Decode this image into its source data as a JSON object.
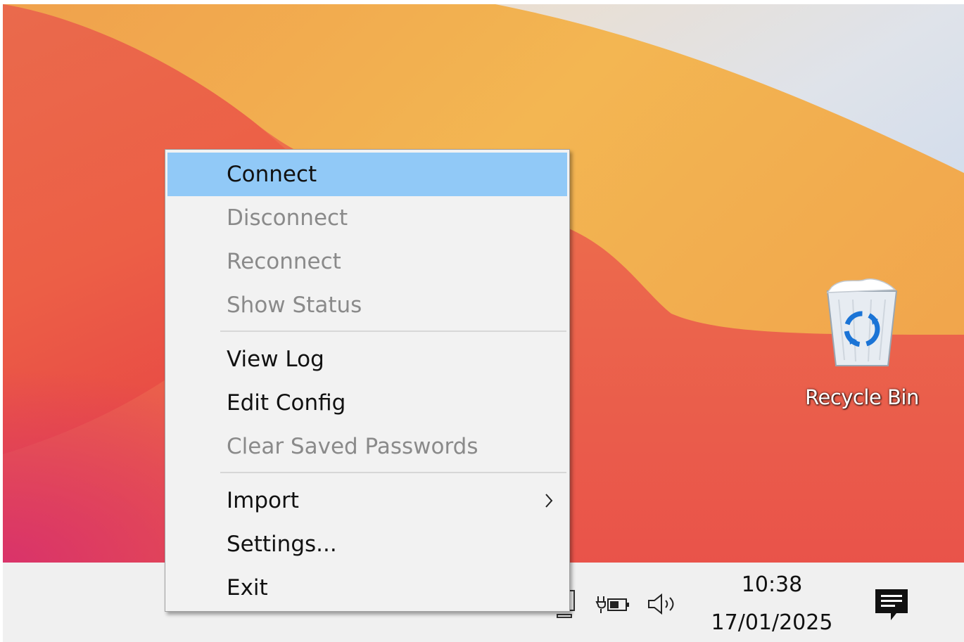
{
  "desktop": {
    "icons": [
      {
        "label": "Recycle Bin",
        "icon": "recycle-bin-icon"
      }
    ]
  },
  "context_menu": {
    "items": [
      {
        "label": "Connect",
        "enabled": true,
        "highlighted": true
      },
      {
        "label": "Disconnect",
        "enabled": false
      },
      {
        "label": "Reconnect",
        "enabled": false
      },
      {
        "label": "Show Status",
        "enabled": false
      },
      {
        "label": "View Log",
        "enabled": true
      },
      {
        "label": "Edit Config",
        "enabled": true
      },
      {
        "label": "Clear Saved Passwords",
        "enabled": false
      },
      {
        "label": "Import",
        "enabled": true,
        "submenu_icon": "chevron-right-icon"
      },
      {
        "label": "Settings...",
        "enabled": true
      },
      {
        "label": "Exit",
        "enabled": true
      }
    ],
    "highlight_color": "#91c9f7",
    "disabled_color": "#8a8a8a"
  },
  "taskbar": {
    "tray_icons": [
      "network-icon",
      "battery-charging-icon",
      "volume-icon"
    ],
    "clock": {
      "time": "10:38",
      "date": "17/01/2025"
    },
    "notification_icon": "action-center-icon"
  },
  "colors": {
    "taskbar_bg": "#f0f0f0",
    "menu_bg": "#f2f2f2"
  }
}
